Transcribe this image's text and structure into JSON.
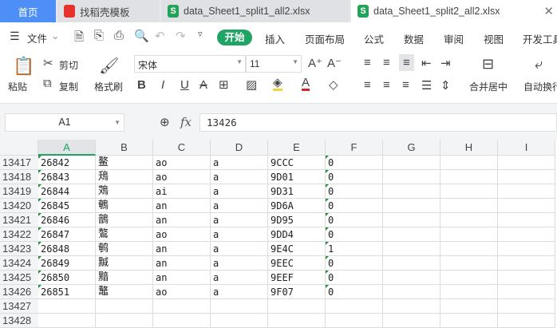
{
  "tabs": [
    {
      "label": "首页"
    },
    {
      "label": "找稻壳模板"
    },
    {
      "label": "data_Sheet1_split1_all2.xlsx"
    },
    {
      "label": "data_Sheet1_split2_all2.xlsx"
    }
  ],
  "menu": {
    "file": "文件",
    "items": [
      "开始",
      "插入",
      "页面布局",
      "公式",
      "数据",
      "审阅",
      "视图",
      "开发工具"
    ]
  },
  "ribbon": {
    "paste": "粘贴",
    "cut": "剪切",
    "copy": "复制",
    "format_painter": "格式刷",
    "font": "宋体",
    "size": "11",
    "merge": "合并居中",
    "wrap": "自动换行"
  },
  "formula": {
    "cell_ref": "A1",
    "fx": "fx",
    "value": "13426"
  },
  "columns": [
    "A",
    "B",
    "C",
    "D",
    "E",
    "F",
    "G",
    "H",
    "I"
  ],
  "rows": [
    {
      "n": "13417",
      "c": [
        "26842",
        "鳌",
        "ao",
        "a",
        "9CCC",
        "0"
      ]
    },
    {
      "n": "13418",
      "c": [
        "26843",
        "鴁",
        "ao",
        "a",
        "9D01",
        "0"
      ]
    },
    {
      "n": "13419",
      "c": [
        "26844",
        "鴱",
        "ai",
        "a",
        "9D31",
        "0"
      ]
    },
    {
      "n": "13420",
      "c": [
        "26845",
        "鵪",
        "an",
        "a",
        "9D6A",
        "0"
      ]
    },
    {
      "n": "13421",
      "c": [
        "26846",
        "鶕",
        "an",
        "a",
        "9D95",
        "0"
      ]
    },
    {
      "n": "13422",
      "c": [
        "26847",
        "鷔",
        "ao",
        "a",
        "9DD4",
        "0"
      ]
    },
    {
      "n": "13423",
      "c": [
        "26848",
        "鹌",
        "an",
        "a",
        "9E4C",
        "1"
      ]
    },
    {
      "n": "13424",
      "c": [
        "26849",
        "黬",
        "an",
        "a",
        "9EEC",
        "0"
      ]
    },
    {
      "n": "13425",
      "c": [
        "26850",
        "黯",
        "an",
        "a",
        "9EEF",
        "0"
      ]
    },
    {
      "n": "13426",
      "c": [
        "26851",
        "鼇",
        "ao",
        "a",
        "9F07",
        "0"
      ]
    },
    {
      "n": "13427",
      "c": [
        "",
        "",
        "",
        "",
        "",
        ""
      ]
    },
    {
      "n": "13428",
      "c": [
        "",
        "",
        "",
        "",
        "",
        ""
      ]
    }
  ]
}
